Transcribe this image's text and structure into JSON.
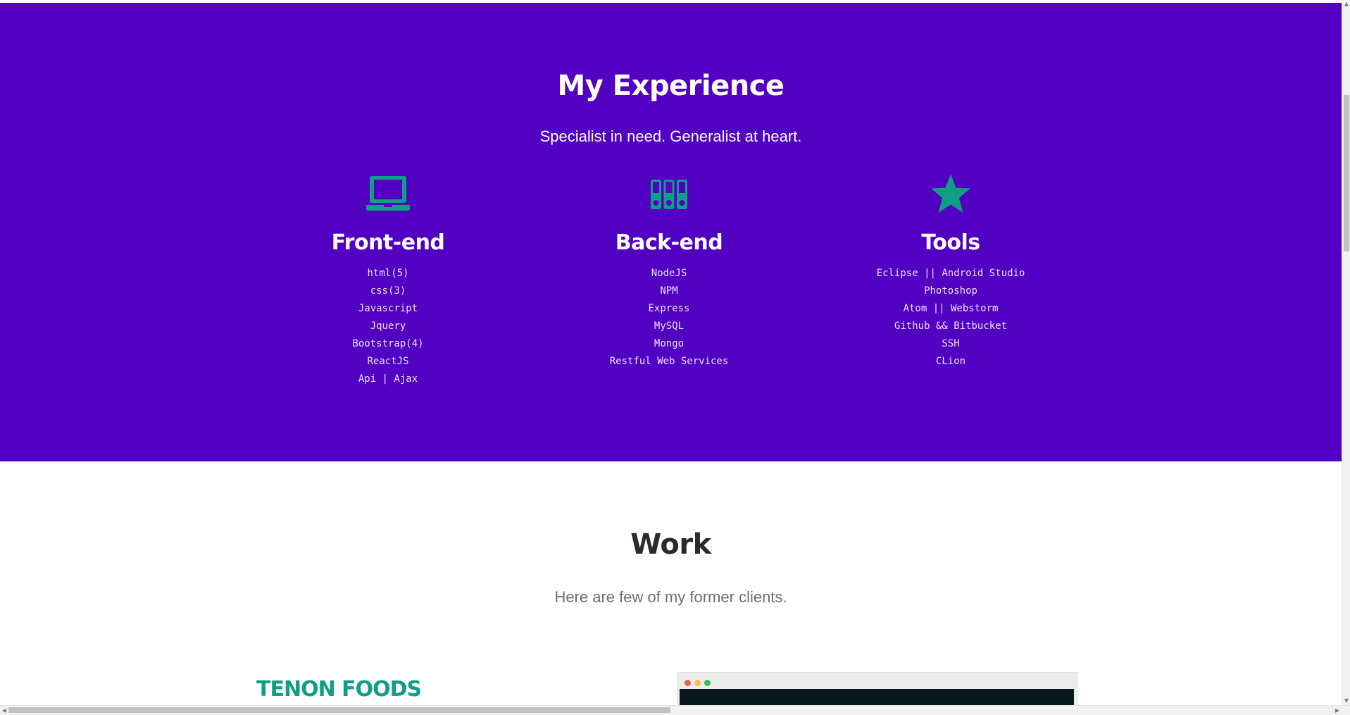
{
  "experience": {
    "title": "My Experience",
    "subtitle": "Specialist in need. Generalist at heart.",
    "background_color": "#5200c2",
    "icon_color": "#0f9e86",
    "columns": [
      {
        "icon": "laptop-icon",
        "title": "Front-end",
        "items": [
          "html(5)",
          "css(3)",
          "Javascript",
          "Jquery",
          "Bootstrap(4)",
          "ReactJS",
          "Api | Ajax"
        ]
      },
      {
        "icon": "server-icon",
        "title": "Back-end",
        "items": [
          "NodeJS",
          "NPM",
          "Express",
          "MySQL",
          "Mongo",
          "Restful Web Services"
        ]
      },
      {
        "icon": "star-icon",
        "title": "Tools",
        "items": [
          "Eclipse || Android Studio",
          "Photoshop",
          "Atom || Webstorm",
          "Github && Bitbucket",
          "SSH",
          "CLion"
        ]
      }
    ]
  },
  "work": {
    "title": "Work",
    "subtitle": "Here are few of my former clients.",
    "clients": [
      {
        "name": "TENON FOODS",
        "name_color": "#0f9e86"
      }
    ]
  },
  "scrollbars": {
    "up_arrow": "▲",
    "down_arrow": "▼",
    "left_arrow": "◀",
    "right_arrow": "▶"
  }
}
